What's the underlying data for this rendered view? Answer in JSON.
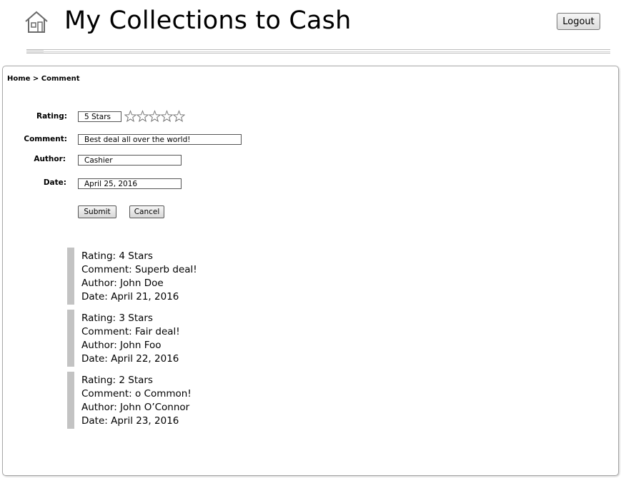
{
  "header": {
    "title": "My Collections to Cash",
    "logout_label": "Logout",
    "home_icon": "house-icon"
  },
  "breadcrumb": {
    "home": "Home",
    "separator": " > ",
    "current": "Comment"
  },
  "form": {
    "rating_label": "Rating:",
    "rating_value": "5 Stars",
    "rating_star_count": 5,
    "rating_stars_filled": 0,
    "comment_label": "Comment:",
    "comment_value": "Best deal all over the world!",
    "author_label": "Author:",
    "author_value": "Cashier",
    "date_label": "Date:",
    "date_value": "April 25, 2016",
    "submit_label": "Submit",
    "cancel_label": "Cancel"
  },
  "comments": [
    {
      "rating": "Rating: 4 Stars",
      "comment": "Comment: Superb deal!",
      "author": "Author: John Doe",
      "date": "Date: April 21, 2016"
    },
    {
      "rating": "Rating: 3 Stars",
      "comment": "Comment: Fair deal!",
      "author": "Author: John Foo",
      "date": "Date: April 22, 2016"
    },
    {
      "rating": "Rating: 2 Stars",
      "comment": "Comment: o Common!",
      "author": "Author: John O’Connor",
      "date": "Date: April 23, 2016"
    }
  ],
  "colors": {
    "comment_bar": "#c3c3c3",
    "panel_border": "#a8a8a8"
  }
}
